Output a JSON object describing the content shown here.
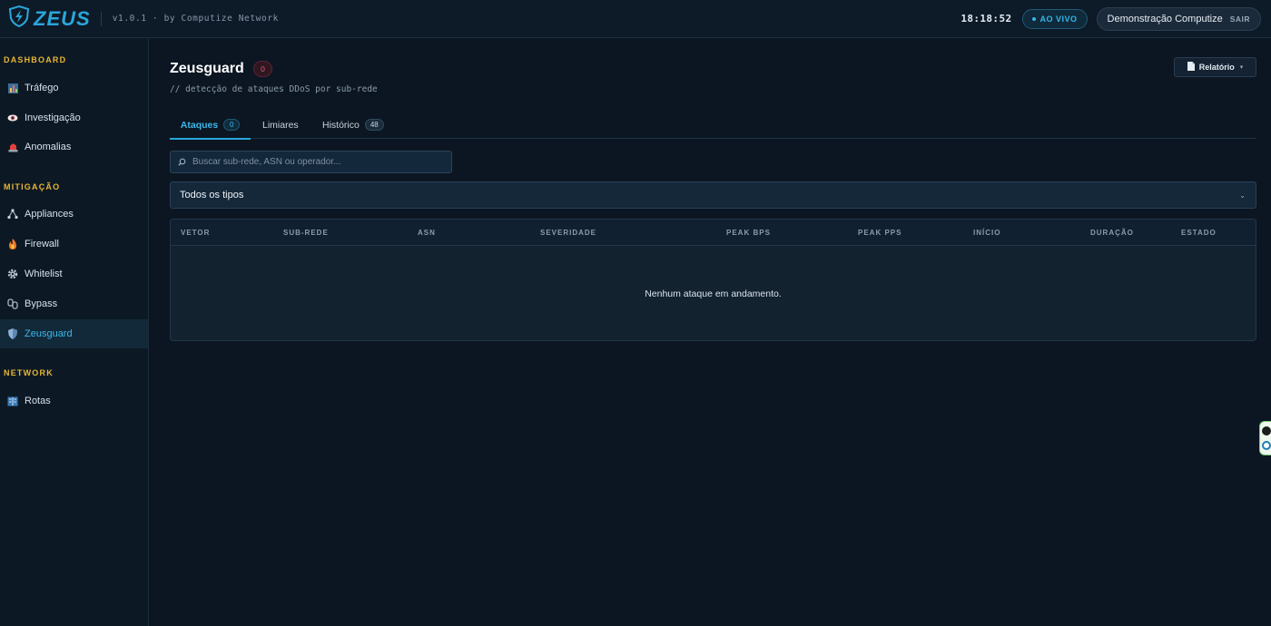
{
  "header": {
    "logo_text": "ZEUS",
    "version": "v1.0.1 · by Computize Network",
    "clock": "18:18:52",
    "live_label": "AO VIVO",
    "user_name": "Demonstração Computize",
    "logout_label": "SAIR"
  },
  "sidebar": {
    "sections": [
      {
        "title": "DASHBOARD",
        "items": [
          {
            "label": "Tráfego",
            "icon": "bar-chart-icon"
          },
          {
            "label": "Investigação",
            "icon": "eye-icon"
          },
          {
            "label": "Anomalias",
            "icon": "alarm-light-icon"
          }
        ]
      },
      {
        "title": "MITIGAÇÃO",
        "items": [
          {
            "label": "Appliances",
            "icon": "network-nodes-icon"
          },
          {
            "label": "Firewall",
            "icon": "fire-icon"
          },
          {
            "label": "Whitelist",
            "icon": "gear-icon"
          },
          {
            "label": "Bypass",
            "icon": "chain-link-icon"
          },
          {
            "label": "Zeusguard",
            "icon": "shield-icon",
            "active": true
          }
        ]
      },
      {
        "title": "NETWORK",
        "items": [
          {
            "label": "Rotas",
            "icon": "book-icon"
          }
        ]
      }
    ]
  },
  "page": {
    "title": "Zeusguard",
    "title_badge": "0",
    "subtitle": "// detecção de ataques DDoS por sub-rede",
    "report_label": "Relatório"
  },
  "tabs": [
    {
      "label": "Ataques",
      "count": "0",
      "active": true
    },
    {
      "label": "Limiares"
    },
    {
      "label": "Histórico",
      "count": "48"
    }
  ],
  "search": {
    "placeholder": "Buscar sub-rede, ASN ou operador...",
    "value": ""
  },
  "type_filter": {
    "selected": "Todos os tipos"
  },
  "table": {
    "columns": [
      "VETOR",
      "SUB-REDE",
      "ASN",
      "SEVERIDADE",
      "PEAK BPS",
      "PEAK PPS",
      "INÍCIO",
      "DURAÇÃO",
      "ESTADO"
    ],
    "empty_message": "Nenhum ataque em andamento."
  },
  "colors": {
    "accent": "#2aa6db",
    "section_title": "#e8b534",
    "background": "#0b1622",
    "danger_badge": "#e65a78"
  }
}
